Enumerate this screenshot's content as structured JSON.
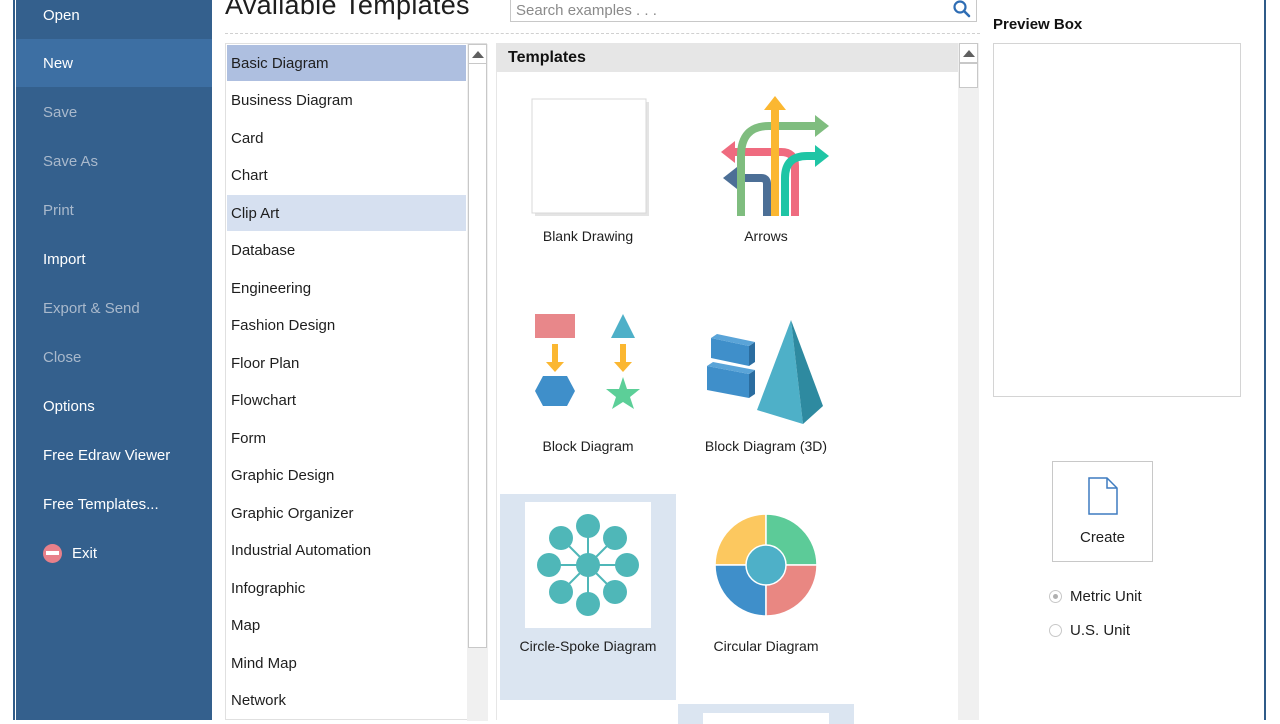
{
  "sidebar": {
    "items": [
      {
        "label": "Open",
        "state": "normal"
      },
      {
        "label": "New",
        "state": "active"
      },
      {
        "label": "Save",
        "state": "disabled"
      },
      {
        "label": "Save As",
        "state": "disabled"
      },
      {
        "label": "Print",
        "state": "disabled"
      },
      {
        "label": "Import",
        "state": "normal"
      },
      {
        "label": "Export & Send",
        "state": "disabled"
      },
      {
        "label": "Close",
        "state": "disabled"
      },
      {
        "label": "Options",
        "state": "normal"
      },
      {
        "label": "Free Edraw Viewer",
        "state": "normal"
      },
      {
        "label": "Free Templates...",
        "state": "normal"
      },
      {
        "label": "Exit",
        "state": "normal",
        "icon": "exit-icon"
      }
    ]
  },
  "header": {
    "title": "Available Templates",
    "search_placeholder": "Search examples . . ."
  },
  "categories": {
    "selected": "Basic Diagram",
    "hovered": "Clip Art",
    "items": [
      "Basic Diagram",
      "Business Diagram",
      "Card",
      "Chart",
      "Clip Art",
      "Database",
      "Engineering",
      "Fashion Design",
      "Floor Plan",
      "Flowchart",
      "Form",
      "Graphic Design",
      "Graphic Organizer",
      "Industrial Automation",
      "Infographic",
      "Map",
      "Mind Map",
      "Network"
    ]
  },
  "templates": {
    "header": "Templates",
    "selected": "Circle-Spoke Diagram",
    "items": [
      {
        "label": "Blank Drawing",
        "icon": "blank-drawing-icon"
      },
      {
        "label": "Arrows",
        "icon": "arrows-icon"
      },
      {
        "label": "Block Diagram",
        "icon": "block-diagram-icon"
      },
      {
        "label": "Block Diagram (3D)",
        "icon": "block-diagram-3d-icon"
      },
      {
        "label": "Circle-Spoke Diagram",
        "icon": "circle-spoke-icon"
      },
      {
        "label": "Circular Diagram",
        "icon": "circular-diagram-icon"
      }
    ]
  },
  "preview": {
    "label": "Preview Box",
    "create_label": "Create",
    "units": [
      {
        "label": "Metric Unit",
        "checked": true
      },
      {
        "label": "U.S. Unit",
        "checked": false
      }
    ]
  },
  "colors": {
    "sidebar_bg": "#34608d",
    "sidebar_active": "#3d6fa3",
    "category_selected": "#aebfe0",
    "category_hover": "#d6e0f0",
    "template_selected": "#dbe5f1"
  }
}
